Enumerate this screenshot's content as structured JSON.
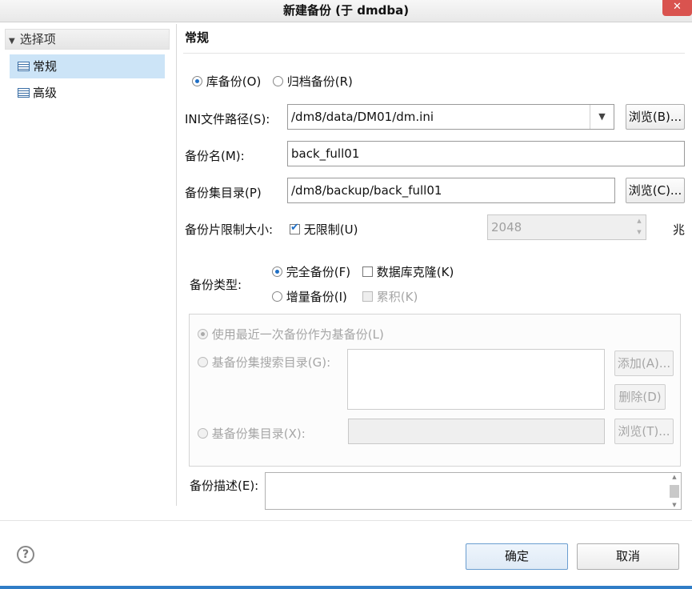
{
  "window": {
    "title": "新建备份  (于 dmdba)",
    "close_label": "✕"
  },
  "nav": {
    "header": "选择项",
    "items": [
      {
        "label": "常规",
        "selected": true
      },
      {
        "label": "高级",
        "selected": false
      }
    ]
  },
  "section": {
    "title": "常规"
  },
  "backup_scope": {
    "db_label": "库备份(O)",
    "archive_label": "归档备份(R)",
    "selected": "db"
  },
  "ini_path": {
    "label": "INI文件路径(S):",
    "value": "/dm8/data/DM01/dm.ini",
    "browse": "浏览(B)..."
  },
  "backup_name": {
    "label": "备份名(M):",
    "value": "back_full01"
  },
  "backup_dir": {
    "label": "备份集目录(P)",
    "value": "/dm8/backup/back_full01",
    "browse": "浏览(C)..."
  },
  "piece_limit": {
    "label": "备份片限制大小:",
    "unlimited_label": "无限制(U)",
    "unlimited": true,
    "size_value": "2048",
    "unit": "兆"
  },
  "backup_type": {
    "label": "备份类型:",
    "full_label": "完全备份(F)",
    "clone_label": "数据库克隆(K)",
    "incremental_label": "增量备份(I)",
    "cumulative_label": "累积(K)",
    "selected": "full"
  },
  "incremental": {
    "use_latest_label": "使用最近一次备份作为基备份(L)",
    "search_dir_label": "基备份集搜索目录(G):",
    "add_button": "添加(A)...",
    "delete_button": "删除(D)",
    "base_dir_label": "基备份集目录(X):",
    "base_dir_value": "",
    "browse_button": "浏览(T)..."
  },
  "description": {
    "label": "备份描述(E):",
    "value": ""
  },
  "footer": {
    "help_symbol": "?",
    "ok_label": "确定",
    "cancel_label": "取消"
  }
}
